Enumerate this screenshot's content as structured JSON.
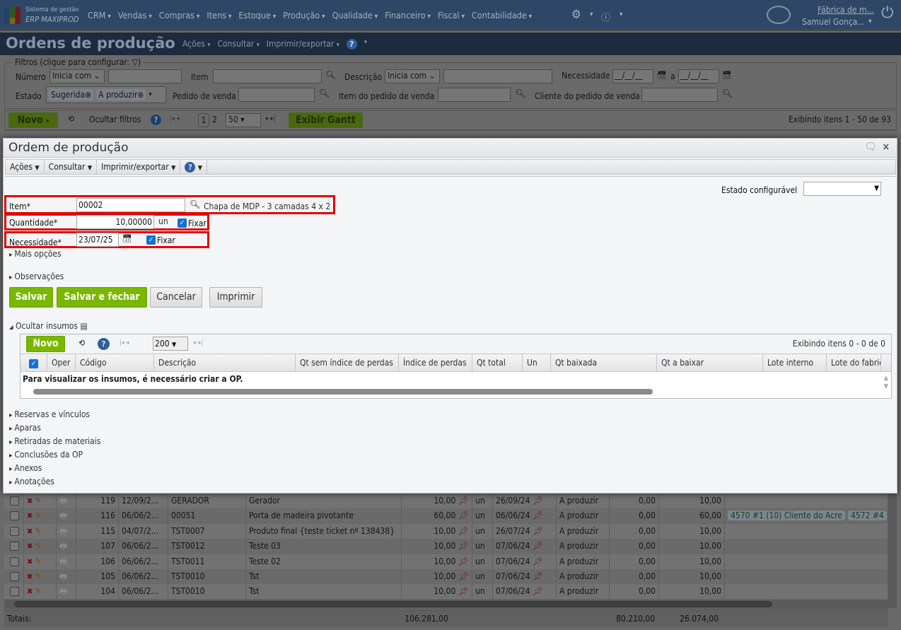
{
  "app": {
    "brand_line1": "Sistema de gestão",
    "brand_line2": "ERP MAXIPROD",
    "menu": [
      "CRM",
      "Vendas",
      "Compras",
      "Itens",
      "Estoque",
      "Produção",
      "Qualidade",
      "Financeiro",
      "Fiscal",
      "Contabilidade"
    ],
    "company": "Fábrica de m...",
    "user": "Samuel Gonça..."
  },
  "page": {
    "title": "Ordens de produção",
    "menu": [
      "Ações",
      "Consultar",
      "Imprimir/exportar"
    ]
  },
  "filters": {
    "legend": "Filtros (clique para configurar:",
    "numero_label": "Número",
    "numero_op": "Inicia com",
    "item_label": "Item",
    "descricao_label": "Descrição",
    "descricao_op": "Inicia com",
    "necessidade_label": "Necessidade",
    "date_placeholder": "__/__/__",
    "a_label": "a",
    "estado_label": "Estado",
    "estado_tags": [
      "Sugerida",
      "A produzir"
    ],
    "pedido_label": "Pedido de venda",
    "item_pedido_label": "Item do pedido de venda",
    "cliente_label": "Cliente do pedido de venda"
  },
  "grid_toolbar": {
    "novo": "Novo",
    "ocultar": "Ocultar filtros",
    "page1": "1",
    "page2": "2",
    "page_size": "50",
    "gantt": "Exibir Gantt",
    "status": "Exibindo itens 1 - 50 de 93"
  },
  "rows": [
    {
      "num": "119",
      "date": "12/09/2...",
      "code": "GERADOR",
      "desc": "Gerador",
      "qty": "10,00",
      "un": "un",
      "nec": "26/09/24",
      "estado": "A produzir",
      "q1": "0,00",
      "q2": "10,00",
      "tags": []
    },
    {
      "num": "116",
      "date": "06/06/2...",
      "code": "00051",
      "desc": "Porta de madeira pivotante",
      "qty": "60,00",
      "un": "un",
      "nec": "06/06/24",
      "estado": "A produzir",
      "q1": "0,00",
      "q2": "60,00",
      "tags": [
        "4570 #1 (10) Cliente do Acre",
        "4572 #4"
      ]
    },
    {
      "num": "115",
      "date": "04/07/2...",
      "code": "TST0007",
      "desc": "Produto final {teste ticket nº 138438}",
      "qty": "10,00",
      "un": "un",
      "nec": "26/07/24",
      "estado": "A produzir",
      "q1": "0,00",
      "q2": "10,00",
      "tags": []
    },
    {
      "num": "107",
      "date": "06/06/2...",
      "code": "TST0012",
      "desc": "Teste 03",
      "qty": "10,00",
      "un": "un",
      "nec": "07/06/24",
      "estado": "A produzir",
      "q1": "0,00",
      "q2": "10,00",
      "tags": []
    },
    {
      "num": "106",
      "date": "06/06/2...",
      "code": "TST0011",
      "desc": "Teste 02",
      "qty": "10,00",
      "un": "un",
      "nec": "07/06/24",
      "estado": "A produzir",
      "q1": "0,00",
      "q2": "10,00",
      "tags": []
    },
    {
      "num": "105",
      "date": "06/06/2...",
      "code": "TST0010",
      "desc": "Tst",
      "qty": "10,00",
      "un": "un",
      "nec": "07/06/24",
      "estado": "A produzir",
      "q1": "0,00",
      "q2": "10,00",
      "tags": []
    },
    {
      "num": "104",
      "date": "06/06/2...",
      "code": "TST0010",
      "desc": "Tst",
      "qty": "10,00",
      "un": "un",
      "nec": "07/06/24",
      "estado": "A produzir",
      "q1": "0,00",
      "q2": "10,00",
      "tags": []
    }
  ],
  "totals": {
    "label": "Totais:",
    "qty": "106.281,00",
    "q1": "80.210,00",
    "q2": "26.074,00"
  },
  "modal": {
    "title": "Ordem de produção",
    "menu": [
      "Ações",
      "Consultar",
      "Imprimir/exportar"
    ],
    "estado_label": "Estado configurável",
    "item_label": "Item*",
    "item_value": "00002",
    "item_desc": "Chapa de MDP - 3 camadas 4 x 2",
    "qtd_label": "Quantidade*",
    "qtd_value": "10,00000",
    "qtd_unit": "un",
    "fixar": "Fixar",
    "nec_label": "Necessidade*",
    "nec_value": "23/07/25",
    "mais_opcoes": "Mais opções",
    "observacoes": "Observações",
    "buttons": {
      "salvar": "Salvar",
      "salvar_fechar": "Salvar e fechar",
      "cancelar": "Cancelar",
      "imprimir": "Imprimir"
    },
    "insumos_toggle": "Ocultar insumos",
    "insumos": {
      "novo": "Novo",
      "page_size": "200",
      "status": "Exibindo itens 0 - 0 de 0",
      "columns": [
        "Oper",
        "Código",
        "Descrição",
        "Qt sem índice de perdas",
        "Índice de perdas",
        "Qt total",
        "Un",
        "Qt baixada",
        "Qt a baixar",
        "Lote interno",
        "Lote do fabric"
      ],
      "empty": "Para visualizar os insumos, é necessário criar a OP."
    },
    "sections": [
      "Reservas e vínculos",
      "Aparas",
      "Retiradas de materiais",
      "Conclusões da OP",
      "Anexos",
      "Anotações"
    ]
  }
}
